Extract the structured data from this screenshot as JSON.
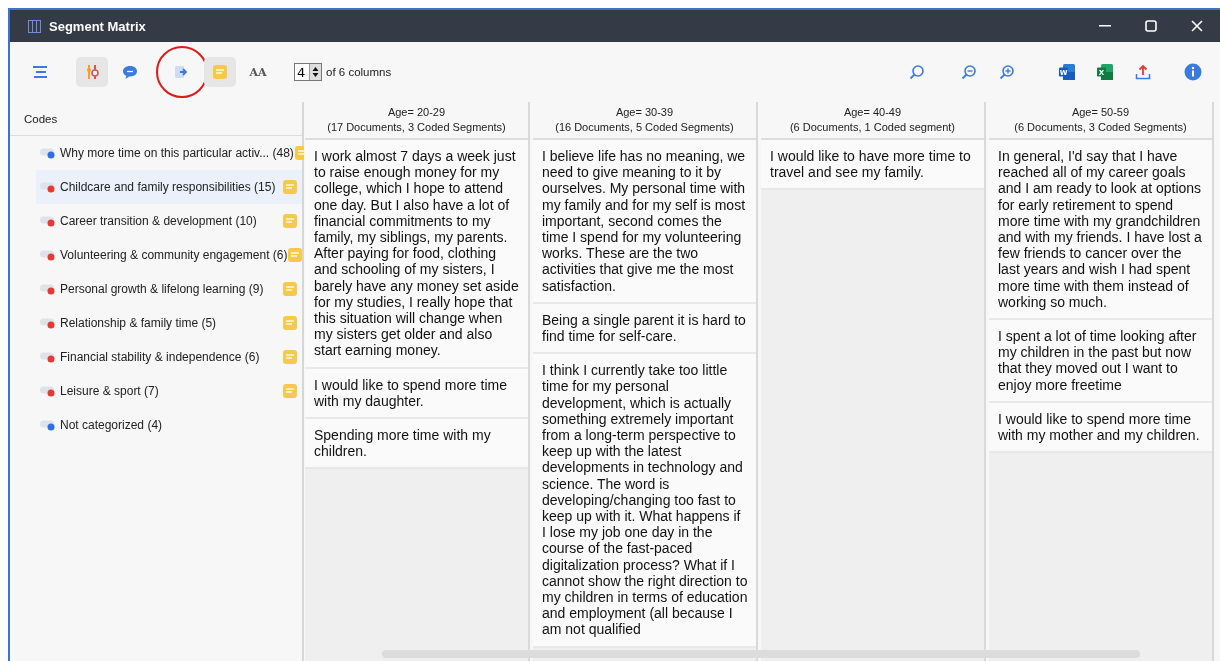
{
  "window": {
    "title": "Segment Matrix"
  },
  "toolbar": {
    "tools": [
      {
        "kind": "menu",
        "selected": false
      },
      {
        "kind": "toggle",
        "selected": true
      },
      {
        "kind": "comment",
        "selected": false
      },
      {
        "kind": "import",
        "selected": false,
        "circled": true
      },
      {
        "kind": "memo",
        "selected": true
      },
      {
        "kind": "font",
        "label": "AA",
        "selected": false
      }
    ],
    "columns_spinner": {
      "value": "4",
      "suffix": "of 6 columns"
    },
    "right_tools": [
      {
        "kind": "search"
      },
      {
        "kind": "zoom-out"
      },
      {
        "kind": "zoom-in"
      },
      {
        "kind": "word",
        "label": "W"
      },
      {
        "kind": "excel",
        "label": "X"
      },
      {
        "kind": "export"
      },
      {
        "kind": "info"
      }
    ]
  },
  "codes": {
    "header": "Codes",
    "items": [
      {
        "label": "Why more time on this particular activ... (48)",
        "color": "#2f6fe4",
        "memo": true,
        "selected": false
      },
      {
        "label": "Childcare and family responsibilities (15)",
        "color": "#e53935",
        "memo": true,
        "selected": true
      },
      {
        "label": "Career transition & development (10)",
        "color": "#e53935",
        "memo": true,
        "selected": false
      },
      {
        "label": "Volunteering & community engagement (6)",
        "color": "#e53935",
        "memo": true,
        "selected": false
      },
      {
        "label": "Personal growth & lifelong learning (9)",
        "color": "#e53935",
        "memo": true,
        "selected": false
      },
      {
        "label": "Relationship & family time (5)",
        "color": "#e53935",
        "memo": true,
        "selected": false
      },
      {
        "label": "Financial stability & independence (6)",
        "color": "#e53935",
        "memo": true,
        "selected": false
      },
      {
        "label": "Leisure & sport (7)",
        "color": "#e53935",
        "memo": true,
        "selected": false
      },
      {
        "label": "Not categorized (4)",
        "color": "#2f6fe4",
        "memo": false,
        "selected": false
      }
    ]
  },
  "matrix": {
    "columns": [
      {
        "title": "Age= 20-29",
        "subtitle": "(17 Documents, 3 Coded Segments)",
        "segments": [
          "I work almost 7 days a week just to raise enough money for my college, which I hope to attend one day. But I also have a lot of financial commitments to my family, my siblings, my parents. After paying for food, clothing and schooling of my sisters, I barely have any money set aside for my studies, I really hope that this situation will change when my sisters get older and also start earning money.",
          "I would like to spend more time with my daughter.",
          "Spending more time with my children."
        ]
      },
      {
        "title": "Age= 30-39",
        "subtitle": "(16 Documents, 5 Coded Segments)",
        "segments": [
          "I believe life has no meaning, we need to give meaning to it by ourselves. My personal time with my family and for my self is most important, second comes the time I spend for my volunteering works. These are the two activities that give me the most satisfaction.",
          "Being a single parent it is hard to find time for self-care.",
          "I think I currently take too little time for my personal development, which is actually something extremely important from a long-term perspective to keep up with the latest developments in technology and science. The word is developing/changing too fast to keep up with it. What happens if I lose my job one day in the course of the fast-paced digitalization process? What if I cannot show the right direction to my children in terms of education and employment (all because I am not qualified"
        ]
      },
      {
        "title": "Age= 40-49",
        "subtitle": "(6 Documents, 1 Coded segment)",
        "segments": [
          "I would like to have more time to travel and see my family."
        ]
      },
      {
        "title": "Age= 50-59",
        "subtitle": "(6 Documents, 3 Coded Segments)",
        "segments": [
          "In general, I'd say that I have reached all of my career goals and I am ready to look at options for early retirement to spend more time with my grandchildren and with my friends.  I have lost a few friends to cancer over the last years and wish I had spent more time with them instead of working so much.",
          "I spent a lot of time looking after my children in the past but now that they moved out I want to enjoy more freetime",
          "I would like to spend more time with my mother and my children."
        ]
      }
    ]
  }
}
